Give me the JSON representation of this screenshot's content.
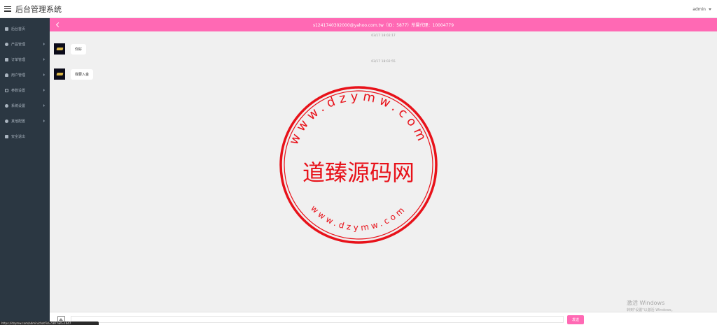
{
  "app": {
    "title": "后台管理系统",
    "user": "admin"
  },
  "sidebar": {
    "items": [
      {
        "label": "后台首页",
        "icon": "dashboard-icon",
        "has_submenu": false
      },
      {
        "label": "产品管理",
        "icon": "gear-icon",
        "has_submenu": true
      },
      {
        "label": "订单管理",
        "icon": "copy-icon",
        "has_submenu": true
      },
      {
        "label": "用户管理",
        "icon": "user-icon",
        "has_submenu": true
      },
      {
        "label": "参数设置",
        "icon": "file-icon",
        "has_submenu": true
      },
      {
        "label": "系统设置",
        "icon": "gears-icon",
        "has_submenu": true
      },
      {
        "label": "其他配置",
        "icon": "cog-icon",
        "has_submenu": true
      },
      {
        "label": "安全退出",
        "icon": "signout-icon",
        "has_submenu": false
      }
    ]
  },
  "chat": {
    "header": "s1241740302000@yahoo.com.tw（ID：5877）所属代理：10004779",
    "messages": [
      {
        "time": "03/17 18:02:17",
        "text": "你好"
      },
      {
        "time": "03/17 18:02:55",
        "text": "我要入金"
      }
    ],
    "input_placeholder": "",
    "send_label": "发送"
  },
  "stamp": {
    "center": "道臻源码网",
    "ring_top": "www.dzymw.com",
    "ring_bottom": "www.dzymw.com",
    "color": "#e8121a"
  },
  "watermark": {
    "line1": "激活 Windows",
    "line2": "转到\"设置\"以激活 Windows。"
  },
  "statusbar": {
    "url": "https://dzymw.com/admin/chat?id=5877&t=1647"
  },
  "colors": {
    "accent": "#ff69b4",
    "sidebar": "#2b3742"
  }
}
